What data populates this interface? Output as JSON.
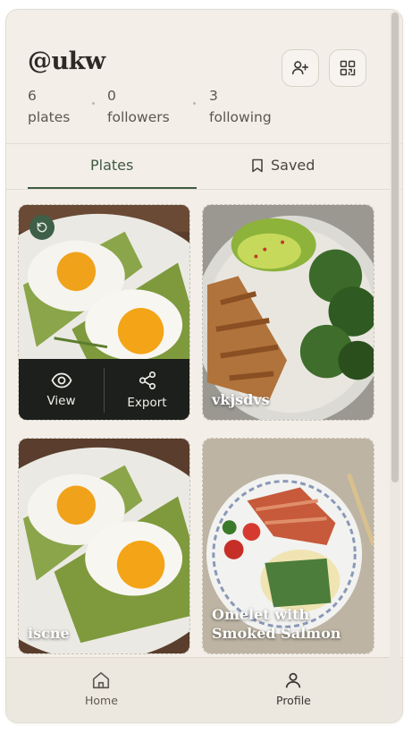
{
  "profile": {
    "handle": "@ukw",
    "stats": [
      {
        "value": "6",
        "label": "plates"
      },
      {
        "value": "0",
        "label": "followers"
      },
      {
        "value": "3",
        "label": "following"
      }
    ]
  },
  "header_icons": {
    "add_friend": "user-plus-icon",
    "qr": "qr-code-icon"
  },
  "tabs": [
    {
      "label": "Plates",
      "active": true
    },
    {
      "label": "Saved",
      "icon": "bookmark-icon",
      "active": false
    }
  ],
  "plates": [
    {
      "caption": "",
      "image": "avocado-toast-eggs",
      "overlay": {
        "view_label": "View",
        "export_label": "Export"
      }
    },
    {
      "caption": "vkjsdvs",
      "image": "chicken-broccoli-bowl"
    },
    {
      "caption": "iscne",
      "image": "avocado-toast-eggs"
    },
    {
      "caption": "Omelet with Smoked Salmon",
      "image": "salmon-omelet-plate"
    }
  ],
  "bottom_nav": [
    {
      "label": "Home",
      "icon": "home-icon"
    },
    {
      "label": "Profile",
      "icon": "person-icon",
      "active": true
    }
  ],
  "colors": {
    "accent": "#3f5a43",
    "background": "#f3efe8",
    "overlay": "#1d1f1c"
  }
}
